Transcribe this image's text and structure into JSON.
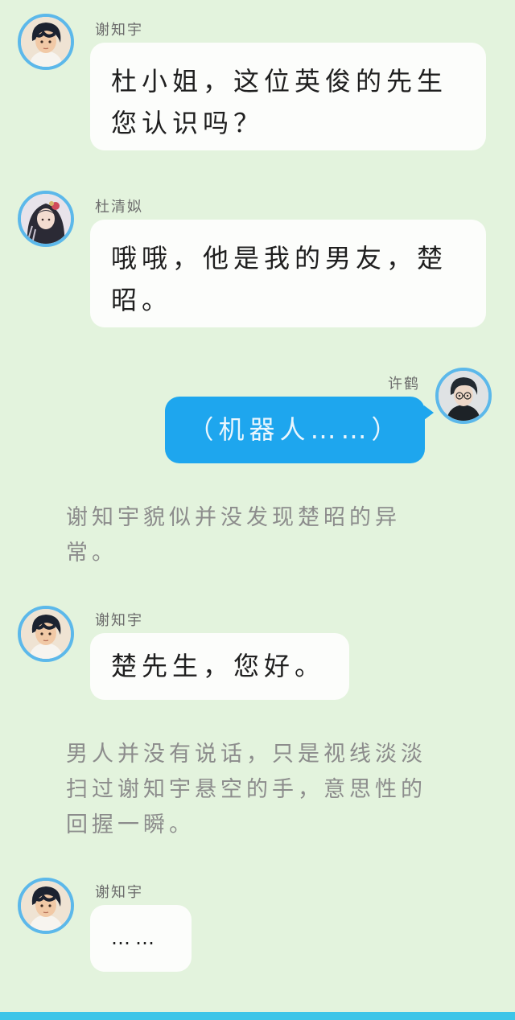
{
  "messages": [
    {
      "speaker": "谢知宇",
      "text": "杜小姐，这位英俊的先生您认识吗？",
      "avatar_icon": "dark-haired-man-avatar-icon"
    },
    {
      "speaker": "杜清姒",
      "text": "哦哦，他是我的男友，楚昭。",
      "avatar_icon": "long-haired-woman-avatar-icon"
    },
    {
      "speaker": "许鹤",
      "text": "（机器人……）",
      "avatar_icon": "man-with-glasses-avatar-icon"
    },
    {
      "narration": "谢知宇貌似并没发现楚昭的异常。"
    },
    {
      "speaker": "谢知宇",
      "text": "楚先生，您好。",
      "avatar_icon": "dark-haired-man-avatar-icon"
    },
    {
      "narration": "男人并没有说话，只是视线淡淡扫过谢知宇悬空的手，意思性的回握一瞬。"
    },
    {
      "speaker": "谢知宇",
      "text": "……",
      "avatar_icon": "dark-haired-man-avatar-icon"
    }
  ],
  "colors": {
    "background": "#e3f3dd",
    "bubble_other": "#fcfdfb",
    "bubble_self": "#1ea6ee",
    "avatar_border": "#5cb8ea",
    "narration_text": "#8c8c8c"
  }
}
